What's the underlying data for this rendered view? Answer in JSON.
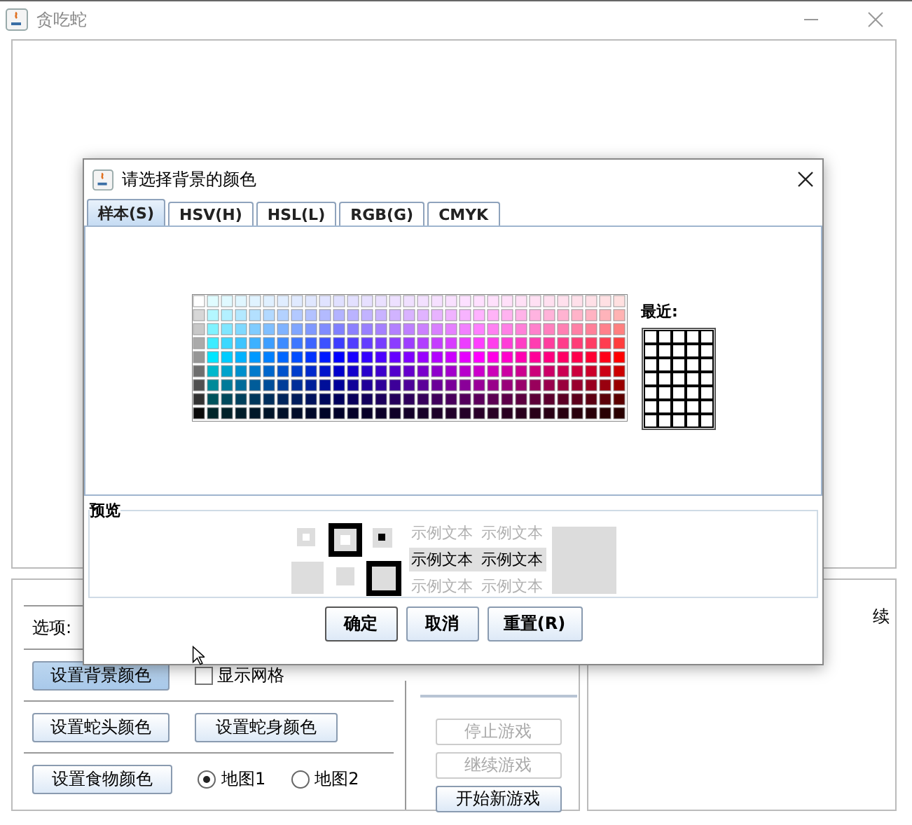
{
  "window": {
    "title": "贪吃蛇"
  },
  "options": {
    "label": "选项:",
    "background_button": {
      "label": "设置背景颜色",
      "pressed": true
    },
    "show_grid": {
      "label": "显示网格",
      "checked": false
    },
    "head_button": {
      "label": "设置蛇头颜色"
    },
    "body_button": {
      "label": "设置蛇身颜色"
    },
    "food_button": {
      "label": "设置食物颜色"
    },
    "maps": [
      {
        "label": "地图1",
        "selected": true
      },
      {
        "label": "地图2",
        "selected": false
      }
    ]
  },
  "game_buttons": [
    {
      "label": "停止游戏",
      "disabled": true
    },
    {
      "label": "继续游戏",
      "disabled": true
    },
    {
      "label": "开始新游戏",
      "disabled": false
    }
  ],
  "side_panel": {
    "text": "续"
  },
  "dialog": {
    "title": "请选择背景的颜色",
    "tabs": [
      {
        "label": "样本(S)",
        "selected": true
      },
      {
        "label": "HSV(H)",
        "selected": false
      },
      {
        "label": "HSL(L)",
        "selected": false
      },
      {
        "label": "RGB(G)",
        "selected": false
      },
      {
        "label": "CMYK",
        "selected": false
      }
    ],
    "recent_label": "最近:",
    "preview": {
      "title": "预览",
      "sample_rows": [
        {
          "kind": "faded",
          "texts": [
            "示例文本",
            "示例文本"
          ]
        },
        {
          "kind": "highlighted",
          "texts": [
            "示例文本",
            "示例文本"
          ]
        },
        {
          "kind": "faded",
          "texts": [
            "示例文本",
            "示例文本"
          ]
        }
      ]
    },
    "buttons": [
      {
        "label": "确定",
        "default": true
      },
      {
        "label": "取消",
        "default": false
      },
      {
        "label": "重置(R)",
        "default": false
      }
    ]
  }
}
